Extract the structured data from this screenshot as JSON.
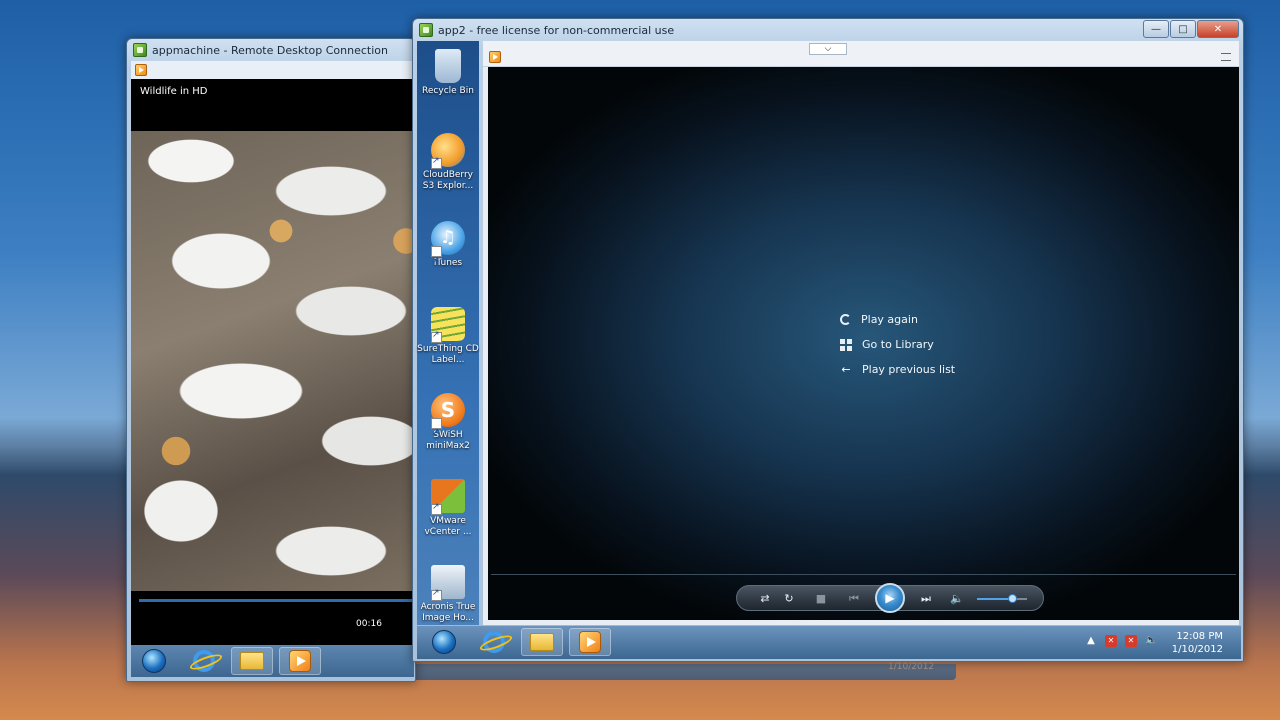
{
  "rdc_window": {
    "title": "appmachine - Remote Desktop Connection",
    "video_title": "Wildlife in HD",
    "timecode": "00:16"
  },
  "app2_window": {
    "title": "app2 - free license for non-commercial use",
    "controls": {
      "minimize": "—",
      "maximize": "□",
      "close": "✕"
    }
  },
  "desktop_icons": [
    {
      "label": "Recycle Bin",
      "icon": "recycle-bin-icon",
      "color": "#b9d4ef"
    },
    {
      "label": "CloudBerry S3 Explor...",
      "icon": "cloudberry-icon",
      "color": "#f29b2a"
    },
    {
      "label": "iTunes",
      "icon": "itunes-icon",
      "color": "#4aa3e6"
    },
    {
      "label": "SureThing CD Label...",
      "icon": "surething-icon",
      "color": "#f0d233"
    },
    {
      "label": "SWiSH miniMax2",
      "icon": "swish-icon",
      "color": "#f07a1c"
    },
    {
      "label": "VMware vCenter ...",
      "icon": "vmware-icon",
      "color": "#e8761e"
    },
    {
      "label": "Acronis True Image Ho...",
      "icon": "acronis-icon",
      "color": "#c9d8e6"
    }
  ],
  "player": {
    "end_menu": [
      {
        "label": "Play again",
        "icon": "replay-icon"
      },
      {
        "label": "Go to Library",
        "icon": "library-icon"
      },
      {
        "label": "Play previous list",
        "icon": "back-arrow-icon"
      }
    ],
    "volume_level": 0.7
  },
  "taskbar": {
    "time": "12:08 PM",
    "date": "1/10/2012"
  },
  "background_date": "1/10/2012",
  "colors": {
    "accent": "#3b8ed0",
    "stage_center": "#27577a"
  }
}
